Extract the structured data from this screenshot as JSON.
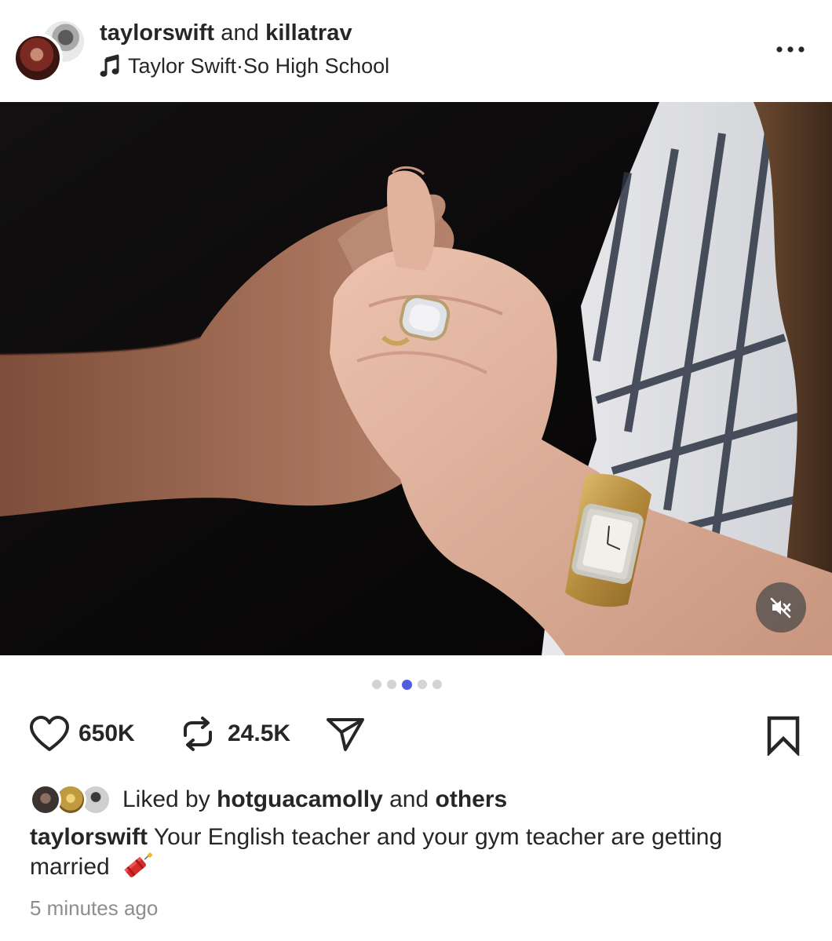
{
  "post": {
    "author_primary": "taylorswift",
    "author_joiner": " and ",
    "author_secondary": "killatrav",
    "music_artist": "Taylor Swift",
    "music_separator": " · ",
    "music_title": "So High School",
    "likes": "650K",
    "reposts": "24.5K",
    "pager": {
      "total": 5,
      "active_index": 2
    },
    "liked_by_prefix": "Liked by ",
    "liked_by_user": "hotguacamolly",
    "liked_by_joiner": " and ",
    "liked_by_others": "others",
    "caption_user": "taylorswift",
    "caption_text": " Your English teacher and your gym teacher are getting married",
    "timestamp": "5 minutes ago"
  },
  "icons": {
    "more": "more-horizontal-icon",
    "music": "music-note-icon",
    "like": "heart-icon",
    "repost": "repost-icon",
    "share": "paper-plane-icon",
    "save": "bookmark-icon",
    "mute": "speaker-muted-icon",
    "emoji": "firecracker-emoji"
  },
  "colors": {
    "text": "#262626",
    "muted_text": "#8e8e8e",
    "pager_active": "#4f5de0",
    "pager_inactive": "#d4d4d4"
  }
}
